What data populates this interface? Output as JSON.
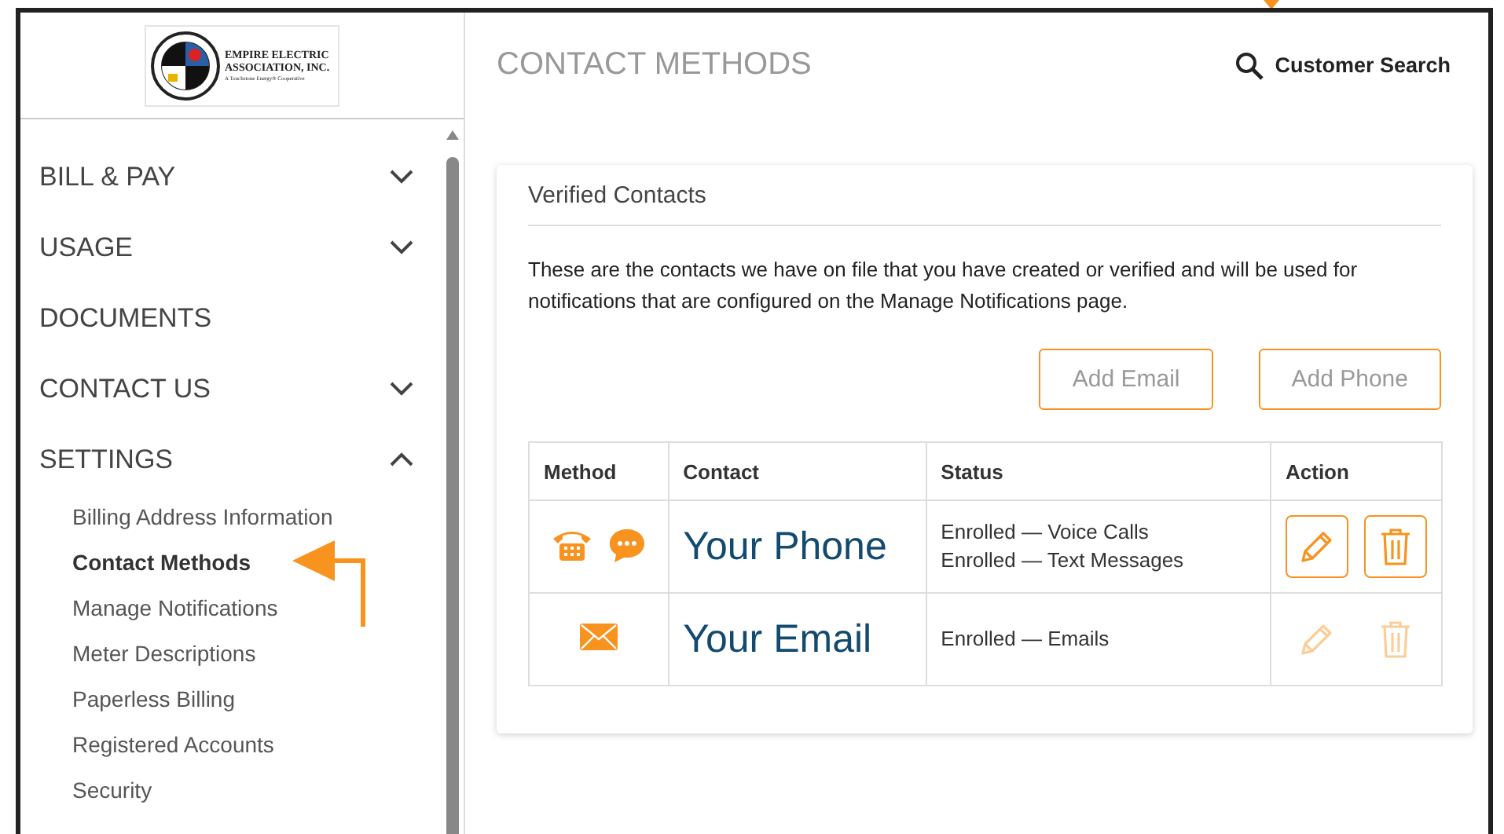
{
  "logo": {
    "name_lines": [
      "EMPIRE ELECTRIC",
      "ASSOCIATION, INC."
    ],
    "tagline": "A Touchstone Energy® Cooperative"
  },
  "sidebar": {
    "items": [
      {
        "label": "BILL & PAY",
        "kind": "menu",
        "expanded": false
      },
      {
        "label": "USAGE",
        "kind": "menu",
        "expanded": false
      },
      {
        "label": "DOCUMENTS",
        "kind": "link"
      },
      {
        "label": "CONTACT US",
        "kind": "menu",
        "expanded": false
      },
      {
        "label": "SETTINGS",
        "kind": "menu",
        "expanded": true,
        "children": [
          {
            "label": "Billing Address Information",
            "selected": false
          },
          {
            "label": "Contact Methods",
            "selected": true
          },
          {
            "label": "Manage Notifications",
            "selected": false
          },
          {
            "label": "Meter Descriptions",
            "selected": false
          },
          {
            "label": "Paperless Billing",
            "selected": false
          },
          {
            "label": "Registered Accounts",
            "selected": false
          },
          {
            "label": "Security",
            "selected": false
          }
        ]
      }
    ]
  },
  "header": {
    "title": "CONTACT METHODS",
    "search_label": "Customer Search"
  },
  "card": {
    "title": "Verified Contacts",
    "description": "These are the contacts we have on file that you have created or verified and will be used for notifications that are configured on the Manage Notifications page.",
    "buttons": [
      "Add Email",
      "Add Phone"
    ],
    "table": {
      "columns": [
        "Method",
        "Contact",
        "Status",
        "Action"
      ],
      "rows": [
        {
          "methods": [
            {
              "kind": "phone"
            },
            {
              "kind": "chat"
            }
          ],
          "contact": "Your Phone",
          "status": [
            "Enrolled — Voice Calls",
            "Enrolled — Text Messages"
          ],
          "actions_enabled": true
        },
        {
          "methods": [
            {
              "kind": "email"
            }
          ],
          "contact": "Your Email",
          "status": [
            "Enrolled — Emails"
          ],
          "actions_enabled": false
        }
      ]
    }
  }
}
